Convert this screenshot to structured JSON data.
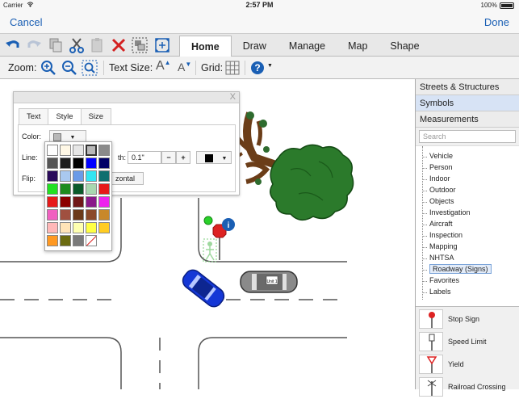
{
  "status_bar": {
    "carrier": "Carrier",
    "time": "2:57 PM",
    "battery": "100%"
  },
  "nav": {
    "cancel": "Cancel",
    "done": "Done"
  },
  "toolbar": {
    "icons": [
      "undo-icon",
      "redo-icon",
      "copy-icon",
      "cut-icon",
      "paste-icon",
      "delete-icon",
      "group-icon",
      "fit-icon"
    ],
    "tabs": [
      {
        "label": "Home",
        "active": true
      },
      {
        "label": "Draw",
        "active": false
      },
      {
        "label": "Manage",
        "active": false
      },
      {
        "label": "Map",
        "active": false
      },
      {
        "label": "Shape",
        "active": false
      }
    ]
  },
  "toolbar2": {
    "zoom_label": "Zoom:",
    "text_size_label": "Text Size:",
    "text_size_increase": "A",
    "text_size_decrease": "A",
    "grid_label": "Grid:"
  },
  "right_panel": {
    "sections": [
      {
        "label": "Streets & Structures",
        "selected": false
      },
      {
        "label": "Symbols",
        "selected": true
      },
      {
        "label": "Measurements",
        "selected": false
      }
    ],
    "search_placeholder": "Search",
    "tree": [
      "Vehicle",
      "Person",
      "Indoor",
      "Outdoor",
      "Objects",
      "Investigation",
      "Aircraft",
      "Inspection",
      "Mapping",
      "NHTSA",
      "Roadway (Signs)",
      "Favorites",
      "Labels"
    ],
    "tree_selected": "Roadway (Signs)",
    "symbols": [
      "Stop Sign",
      "Speed Limit",
      "Yield",
      "Railroad Crossing"
    ]
  },
  "popup": {
    "close": "X",
    "tabs": [
      {
        "label": "Text",
        "active": false
      },
      {
        "label": "Style",
        "active": true
      },
      {
        "label": "Size",
        "active": false
      }
    ],
    "color_label": "Color:",
    "line_label": "Line:",
    "width_label_partial": "th:",
    "width_value": "0.1\"",
    "minus": "−",
    "plus": "+",
    "flip_label": "Flip:",
    "flip_partial": "zontal",
    "selected_color": "#b8b8b8",
    "line_color": "#000000"
  },
  "palette": {
    "colors": [
      "#ffffff",
      "#fff8e6",
      "#e6e6e6",
      "#b8b8b8",
      "#8a8a8a",
      "#555555",
      "#1e1e1e",
      "#000000",
      "#0000ff",
      "#000066",
      "#2a0a5a",
      "#a9c8f0",
      "#6a9be8",
      "#33e5f2",
      "#0f6f6f",
      "#22e022",
      "#1e8b1e",
      "#0a5a2a",
      "#a8d8b0",
      "#e61919",
      "#e61a1a",
      "#8b0000",
      "#701818",
      "#8a1a8a",
      "#ee22ee",
      "#f060c0",
      "#a05040",
      "#6b3a1a",
      "#8b4a2a",
      "#c8882a",
      "#ffb8b8",
      "#ffe4b8",
      "#ffffb0",
      "#ffff44",
      "#ffcc22",
      "#ff9922",
      "#6b6b10",
      "#7a7a7a",
      "none",
      null
    ],
    "selected": "#b8b8b8"
  },
  "canvas": {
    "car_label": "Unit 1"
  }
}
